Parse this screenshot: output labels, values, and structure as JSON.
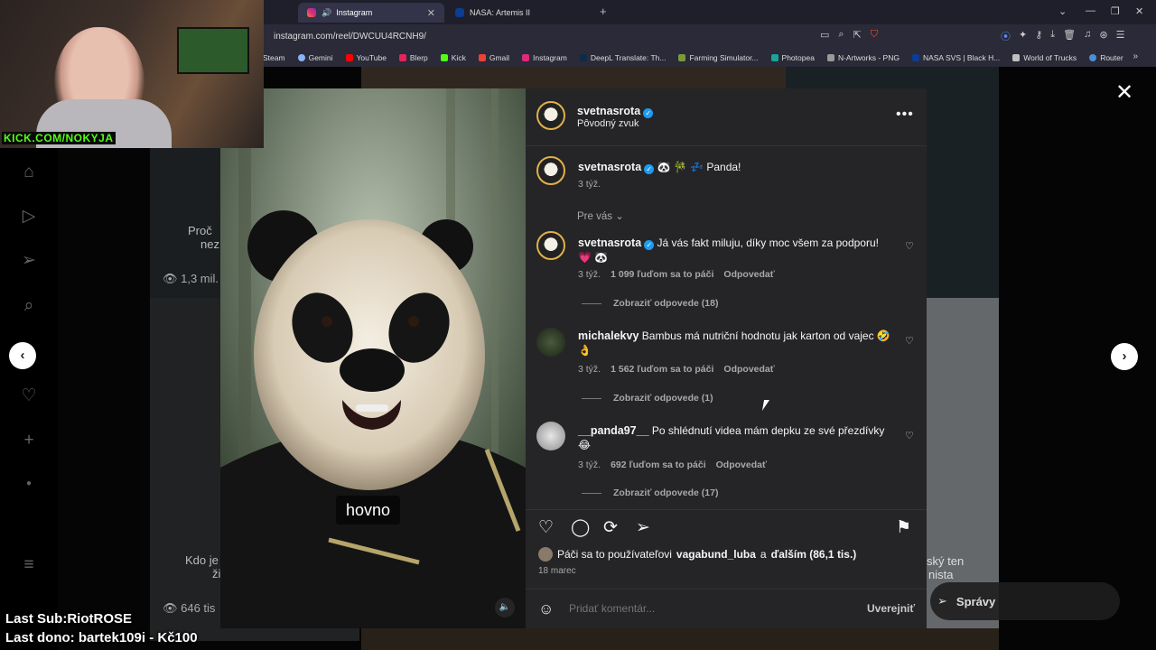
{
  "browser": {
    "tabs": [
      {
        "label": "Instagram",
        "active": true
      },
      {
        "label": "NASA: Artemis II",
        "active": false
      }
    ],
    "url": "instagram.com/reel/DWCUU4RCNH9/",
    "bookmarks": [
      "Steam",
      "Gemini",
      "YouTube",
      "Blerp",
      "Kick",
      "Gmail",
      "Instagram",
      "DeepL Translate: Th...",
      "Farming Simulator...",
      "Photopea",
      "N-Artworks - PNG",
      "NASA SVS | Black H...",
      "World of Trucks",
      "Router"
    ]
  },
  "post": {
    "username": "svetnasrota",
    "audio": "Pôvodný zvuk",
    "caption_text": "🐼 🎋 💤 Panda!",
    "caption_time": "3 týž.",
    "sort_label": "Pre vás",
    "video_caption": "hovno"
  },
  "comments": [
    {
      "user": "svetnasrota",
      "verified": true,
      "text": "Já vás fakt miluju, díky moc všem za podporu! 💗 🐼",
      "time": "3 týž.",
      "likes": "1 099 ľuďom sa to páči",
      "reply": "Odpovedať",
      "view_replies": "Zobraziť odpovede (18)"
    },
    {
      "user": "michalekvy",
      "verified": false,
      "text": "Bambus má nutriční hodnotu jak karton od vajec 🤣 👌",
      "time": "3 týž.",
      "likes": "1 562 ľuďom sa to páči",
      "reply": "Odpovedať",
      "view_replies": "Zobraziť odpovede (1)"
    },
    {
      "user": "__panda97__",
      "verified": false,
      "text": "Po shlédnutí videa mám depku ze své přezdívky 😂",
      "time": "3 týž.",
      "likes": "692 ľuďom sa to páči",
      "reply": "Odpovedať",
      "view_replies": "Zobraziť odpovede (17)"
    }
  ],
  "likes_line": {
    "prefix": "Páči sa to používateľovi",
    "user": "vagabund_luba",
    "joiner": "a",
    "others": "ďalším (86,1 tis.)"
  },
  "post_date": "18 marec",
  "add_comment": {
    "placeholder": "Pridať komentár...",
    "post_label": "Uverejniť"
  },
  "background": {
    "text_left_1": "Proč",
    "text_left_1b": "nez",
    "views_1": "1,3 mil.",
    "text_left_2": "Kdo je",
    "text_left_2b": "ži",
    "views_2": "646 tis",
    "text_right": "ský ten",
    "text_right_b": "nista",
    "messages": "Správy"
  },
  "stream_overlay": {
    "kick_url": "KICK.COM/NOKYJA",
    "last_sub": "Last Sub:RiotROSE",
    "last_dono": "Last dono: bartek109i - Kč100"
  },
  "colors": {
    "accent_blue": "#1d9bf0",
    "panel_bg": "#252527",
    "kick_green": "#53fc18"
  }
}
